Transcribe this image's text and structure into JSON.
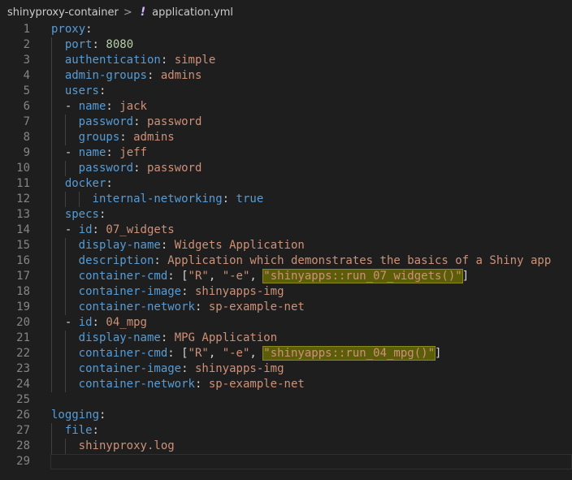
{
  "breadcrumb": {
    "folder": "shinyproxy-container",
    "separator": ">",
    "file_icon": "!",
    "file": "application.yml"
  },
  "colors": {
    "background": "#1e1e1e",
    "key": "#569cd6",
    "string": "#ce9178",
    "number": "#b5cea8",
    "highlight": "#5b5d09"
  },
  "editor": {
    "lines": [
      {
        "n": "1",
        "indent": 0,
        "dash": false,
        "key": "proxy",
        "colon": ":",
        "value": ""
      },
      {
        "n": "2",
        "indent": 1,
        "dash": false,
        "key": "port",
        "colon": ": ",
        "value": "8080",
        "vtype": "n"
      },
      {
        "n": "3",
        "indent": 1,
        "dash": false,
        "key": "authentication",
        "colon": ": ",
        "value": "simple"
      },
      {
        "n": "4",
        "indent": 1,
        "dash": false,
        "key": "admin-groups",
        "colon": ": ",
        "value": "admins"
      },
      {
        "n": "5",
        "indent": 1,
        "dash": false,
        "key": "users",
        "colon": ":",
        "value": ""
      },
      {
        "n": "6",
        "indent": 1,
        "dash": true,
        "key": "name",
        "colon": ": ",
        "value": "jack"
      },
      {
        "n": "7",
        "indent": 2,
        "dash": false,
        "key": "password",
        "colon": ": ",
        "value": "password"
      },
      {
        "n": "8",
        "indent": 2,
        "dash": false,
        "key": "groups",
        "colon": ": ",
        "value": "admins"
      },
      {
        "n": "9",
        "indent": 1,
        "dash": true,
        "key": "name",
        "colon": ": ",
        "value": "jeff"
      },
      {
        "n": "10",
        "indent": 2,
        "dash": false,
        "key": "password",
        "colon": ": ",
        "value": "password"
      },
      {
        "n": "11",
        "indent": 1,
        "dash": false,
        "key": "docker",
        "colon": ":",
        "value": ""
      },
      {
        "n": "12",
        "indent": 3,
        "dash": false,
        "key": "internal-networking",
        "colon": ": ",
        "value": "true",
        "vtype": "k"
      },
      {
        "n": "13",
        "indent": 1,
        "dash": false,
        "key": "specs",
        "colon": ":",
        "value": ""
      },
      {
        "n": "14",
        "indent": 1,
        "dash": true,
        "key": "id",
        "colon": ": ",
        "value": "07_widgets"
      },
      {
        "n": "15",
        "indent": 2,
        "dash": false,
        "key": "display-name",
        "colon": ": ",
        "value": "Widgets Application"
      },
      {
        "n": "16",
        "indent": 2,
        "dash": false,
        "key": "description",
        "colon": ": ",
        "value": "Application which demonstrates the basics of a Shiny app"
      },
      {
        "n": "17",
        "indent": 2,
        "dash": false,
        "key": "container-cmd",
        "colon": ": ",
        "list": [
          "\"R\"",
          "\"-e\"",
          "\"shinyapps::run_07_widgets()\""
        ],
        "highlight_last": true
      },
      {
        "n": "18",
        "indent": 2,
        "dash": false,
        "key": "container-image",
        "colon": ": ",
        "value": "shinyapps-img"
      },
      {
        "n": "19",
        "indent": 2,
        "dash": false,
        "key": "container-network",
        "colon": ": ",
        "value": "sp-example-net"
      },
      {
        "n": "20",
        "indent": 1,
        "dash": true,
        "key": "id",
        "colon": ": ",
        "value": "04_mpg"
      },
      {
        "n": "21",
        "indent": 2,
        "dash": false,
        "key": "display-name",
        "colon": ": ",
        "value": "MPG Application"
      },
      {
        "n": "22",
        "indent": 2,
        "dash": false,
        "key": "container-cmd",
        "colon": ": ",
        "list": [
          "\"R\"",
          "\"-e\"",
          "\"shinyapps::run_04_mpg()\""
        ],
        "highlight_last": true
      },
      {
        "n": "23",
        "indent": 2,
        "dash": false,
        "key": "container-image",
        "colon": ": ",
        "value": "shinyapps-img"
      },
      {
        "n": "24",
        "indent": 2,
        "dash": false,
        "key": "container-network",
        "colon": ": ",
        "value": "sp-example-net"
      },
      {
        "n": "25",
        "indent": 0,
        "dash": false,
        "key": "",
        "colon": "",
        "value": ""
      },
      {
        "n": "26",
        "indent": 0,
        "dash": false,
        "key": "logging",
        "colon": ":",
        "value": ""
      },
      {
        "n": "27",
        "indent": 1,
        "dash": false,
        "key": "file",
        "colon": ":",
        "value": ""
      },
      {
        "n": "28",
        "indent": 2,
        "dash": false,
        "key": "",
        "colon": "",
        "value": "shinyproxy.log"
      },
      {
        "n": "29",
        "indent": 0,
        "dash": false,
        "key": "",
        "colon": "",
        "value": "",
        "current": true
      }
    ]
  }
}
